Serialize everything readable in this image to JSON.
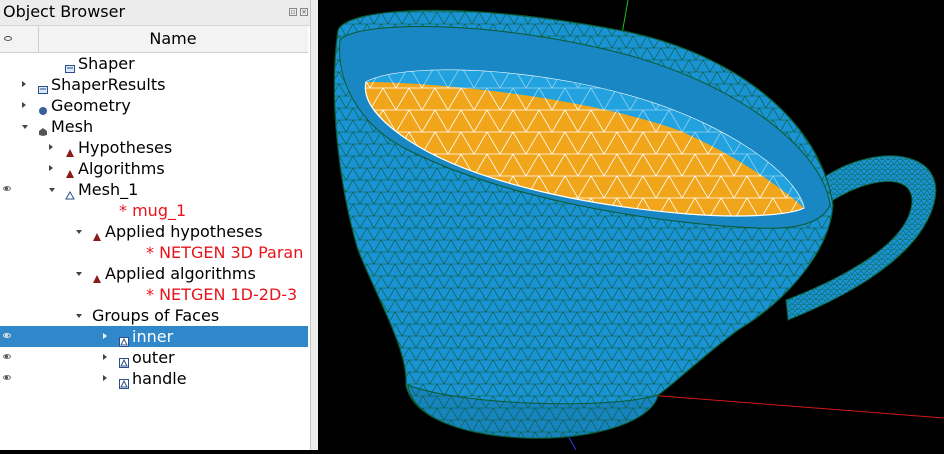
{
  "panel": {
    "title": "Object Browser",
    "column_header": "Name"
  },
  "tree": [
    {
      "label": "Shaper",
      "icon": "shaper-module-icon",
      "expander": "none",
      "visible": false,
      "red": false,
      "selected": false
    },
    {
      "label": "ShaperResults",
      "icon": "shaper-results-icon",
      "expander": "collapsed",
      "visible": false,
      "red": false,
      "selected": false
    },
    {
      "label": "Geometry",
      "icon": "geometry-module-icon",
      "expander": "collapsed",
      "visible": false,
      "red": false,
      "selected": false
    },
    {
      "label": "Mesh",
      "icon": "mesh-module-icon",
      "expander": "expanded",
      "visible": false,
      "red": false,
      "selected": false
    },
    {
      "label": "Hypotheses",
      "icon": "hypotheses-icon",
      "expander": "collapsed",
      "visible": false,
      "red": false,
      "selected": false
    },
    {
      "label": "Algorithms",
      "icon": "algorithms-icon",
      "expander": "collapsed",
      "visible": false,
      "red": false,
      "selected": false
    },
    {
      "label": "Mesh_1",
      "icon": "mesh-object-icon",
      "expander": "expanded",
      "visible": true,
      "red": false,
      "selected": false
    },
    {
      "label": "* mug_1",
      "icon": "",
      "expander": "none",
      "visible": false,
      "red": true,
      "selected": false
    },
    {
      "label": "Applied hypotheses",
      "icon": "applied-hypotheses-icon",
      "expander": "expanded",
      "visible": false,
      "red": false,
      "selected": false
    },
    {
      "label": "* NETGEN 3D Paran",
      "icon": "",
      "expander": "none",
      "visible": false,
      "red": true,
      "selected": false
    },
    {
      "label": "Applied algorithms",
      "icon": "applied-algorithms-icon",
      "expander": "expanded",
      "visible": false,
      "red": false,
      "selected": false
    },
    {
      "label": "* NETGEN 1D-2D-3",
      "icon": "",
      "expander": "none",
      "visible": false,
      "red": true,
      "selected": false
    },
    {
      "label": "Groups of Faces",
      "icon": "",
      "expander": "expanded",
      "visible": false,
      "red": false,
      "selected": false
    },
    {
      "label": "inner",
      "icon": "face-group-icon",
      "expander": "collapsed",
      "visible": true,
      "red": false,
      "selected": true
    },
    {
      "label": "outer",
      "icon": "face-group-icon",
      "expander": "collapsed",
      "visible": true,
      "red": false,
      "selected": false
    },
    {
      "label": "handle",
      "icon": "face-group-icon",
      "expander": "collapsed",
      "visible": true,
      "red": false,
      "selected": false
    }
  ],
  "viewer": {
    "content": "3d-mesh-view",
    "mesh_color": "#1a93d4",
    "inner_color": "#f0a51a",
    "edge_color": "#0b5a2f",
    "background": "#000000"
  },
  "colors": {
    "selection": "#3087c9",
    "red_text": "#e8141a"
  }
}
